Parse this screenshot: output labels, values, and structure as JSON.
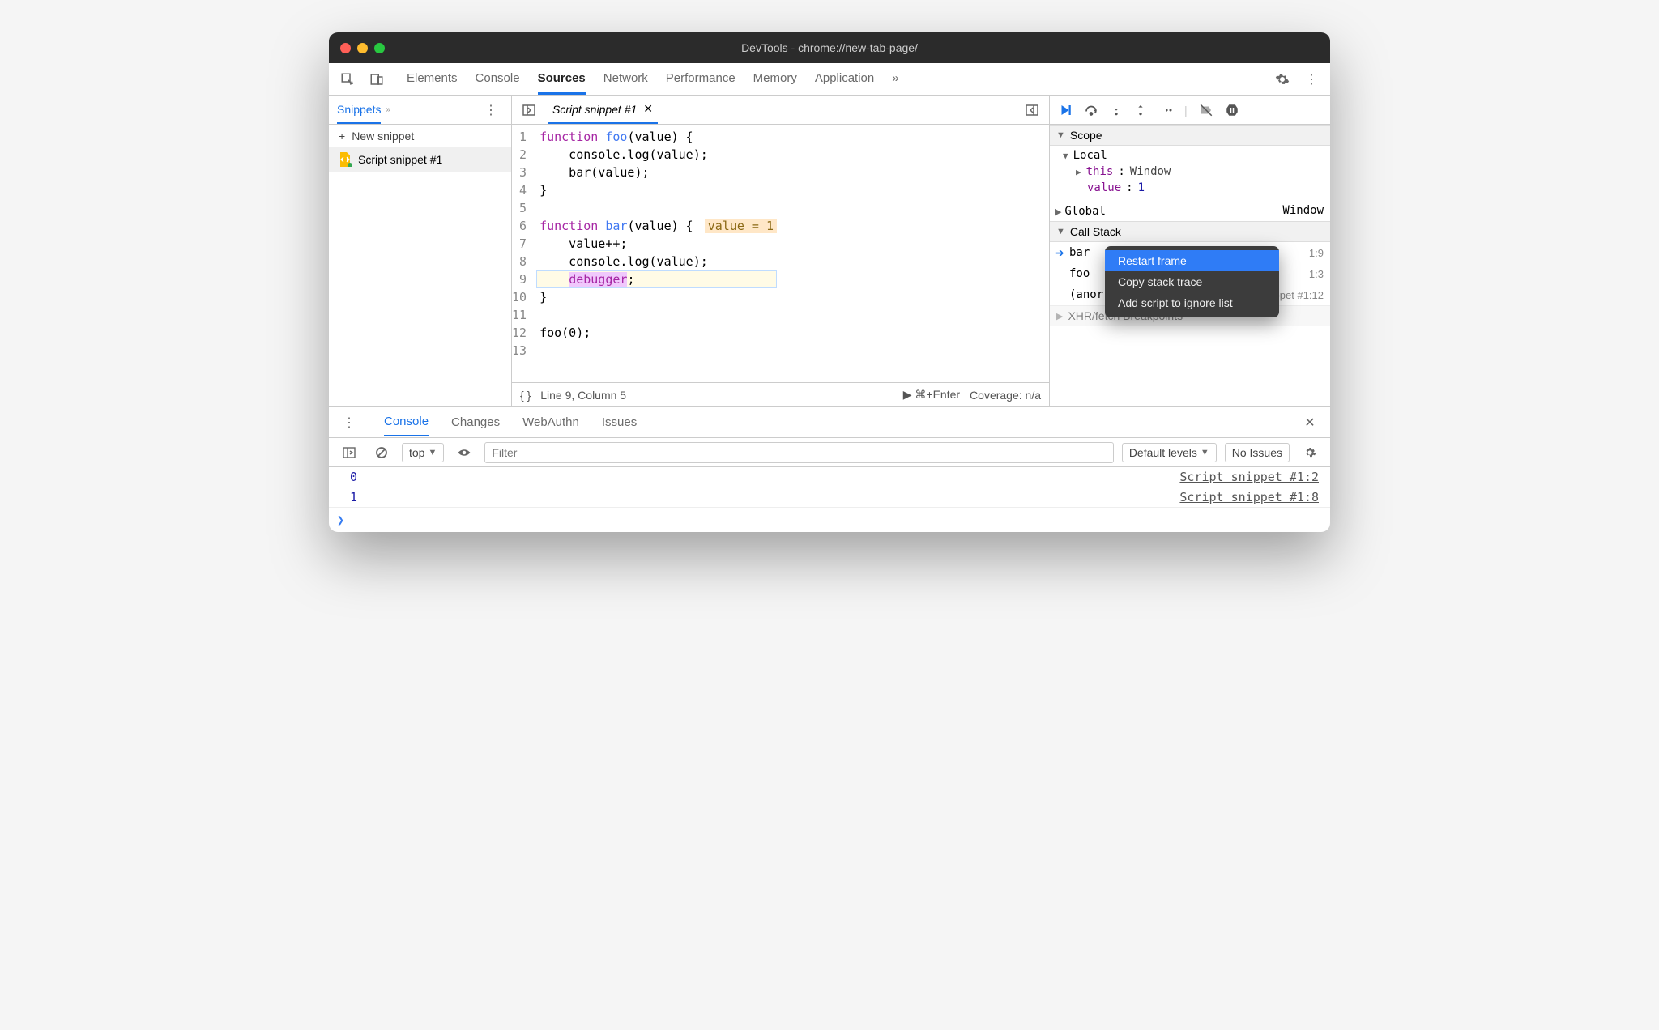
{
  "window": {
    "title": "DevTools - chrome://new-tab-page/"
  },
  "mainTabs": [
    "Elements",
    "Console",
    "Sources",
    "Network",
    "Performance",
    "Memory",
    "Application"
  ],
  "activeMainTab": "Sources",
  "sidebar": {
    "tabLabel": "Snippets",
    "newLabel": "New snippet",
    "file": "Script snippet #1"
  },
  "editor": {
    "tabLabel": "Script snippet #1",
    "gutterStart": 1,
    "lineCount": 13,
    "currentLine": 9,
    "inlineValue": "value = 1",
    "code": {
      "l1": {
        "kw": "function",
        "fn": " foo",
        "rest": "(value) {"
      },
      "l2": "    console.log(value);",
      "l3": "    bar(value);",
      "l4": "}",
      "l5": "",
      "l6": {
        "kw": "function",
        "fn": " bar",
        "rest": "(value) {"
      },
      "l7": "    value++;",
      "l8": "    console.log(value);",
      "l9": {
        "indent": "    ",
        "dbg": "debugger",
        "semi": ";"
      },
      "l10": "}",
      "l11": "",
      "l12": "foo(0);",
      "l13": ""
    },
    "status": {
      "pos": "Line 9, Column 5",
      "run": "⌘+Enter",
      "coverage": "Coverage: n/a"
    }
  },
  "debugger": {
    "scope": {
      "title": "Scope",
      "localLabel": "Local",
      "thisLabel": "this",
      "thisValue": "Window",
      "valueLabel": "value",
      "valueValue": "1",
      "globalLabel": "Global",
      "globalValue": "Window"
    },
    "callStack": {
      "title": "Call Stack",
      "frames": [
        {
          "name": "bar",
          "loc": "1:9"
        },
        {
          "name": "foo",
          "loc": "1:3"
        },
        {
          "name": "(anor",
          "loc": "Script snippet #1:12"
        }
      ]
    },
    "xhr": "XHR/fetch Breakpoints",
    "contextMenu": [
      "Restart frame",
      "Copy stack trace",
      "Add script to ignore list"
    ]
  },
  "drawer": {
    "tabs": [
      "Console",
      "Changes",
      "WebAuthn",
      "Issues"
    ],
    "activeTab": "Console",
    "contextLabel": "top",
    "filterPlaceholder": "Filter",
    "levelsLabel": "Default levels",
    "issuesLabel": "No Issues",
    "logs": [
      {
        "value": "0",
        "source": "Script snippet #1:2"
      },
      {
        "value": "1",
        "source": "Script snippet #1:8"
      }
    ]
  }
}
